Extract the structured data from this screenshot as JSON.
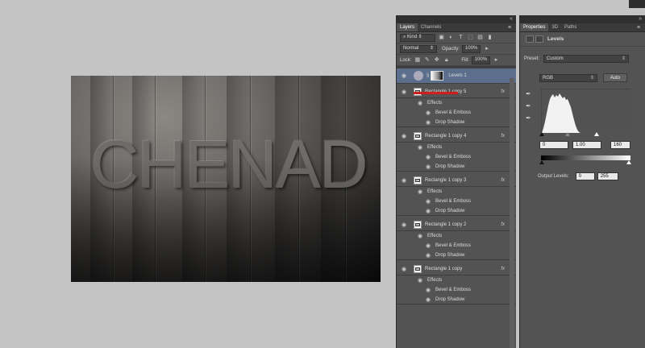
{
  "canvas": {
    "text": "CHENAD"
  },
  "layers_panel": {
    "tabs": [
      "Layers",
      "Channels"
    ],
    "filter": {
      "kind_label": "Kind"
    },
    "blend_mode": "Normal",
    "opacity_label": "Opacity:",
    "opacity_value": "100%",
    "lock_label": "Lock:",
    "fill_label": "Fill:",
    "fill_value": "100%",
    "layers": [
      {
        "name": "Levels 1",
        "selected": true,
        "effects": []
      },
      {
        "name": "Rectangle 1 copy 5",
        "fx": "fx",
        "effects_label": "Effects",
        "effects": [
          "Bevel & Emboss",
          "Drop Shadow"
        ]
      },
      {
        "name": "Rectangle 1 copy 4",
        "fx": "fx",
        "effects_label": "Effects",
        "effects": [
          "Bevel & Emboss",
          "Drop Shadow"
        ]
      },
      {
        "name": "Rectangle 1 copy 3",
        "fx": "fx",
        "effects_label": "Effects",
        "effects": [
          "Bevel & Emboss",
          "Drop Shadow"
        ]
      },
      {
        "name": "Rectangle 1 copy 2",
        "fx": "fx",
        "effects_label": "Effects",
        "effects": [
          "Bevel & Emboss",
          "Drop Shadow"
        ]
      },
      {
        "name": "Rectangle 1 copy",
        "fx": "fx",
        "effects_label": "Effects",
        "effects": [
          "Bevel & Emboss",
          "Drop Shadow"
        ]
      }
    ]
  },
  "properties_panel": {
    "tabs": [
      "Properties",
      "3D",
      "Paths"
    ],
    "title": "Levels",
    "preset_label": "Preset:",
    "preset_value": "Custom",
    "channel": "RGB",
    "auto_button": "Auto",
    "input_black": "0",
    "input_gamma": "1.00",
    "input_white": "160",
    "output_label": "Output Levels:",
    "output_black": "0",
    "output_white": "255"
  },
  "colors": {
    "panel_bg": "#535353",
    "selected_layer": "#5b6f8c",
    "highlight_underline": "#d21d1d",
    "workspace_bg": "#c4c4c4"
  }
}
